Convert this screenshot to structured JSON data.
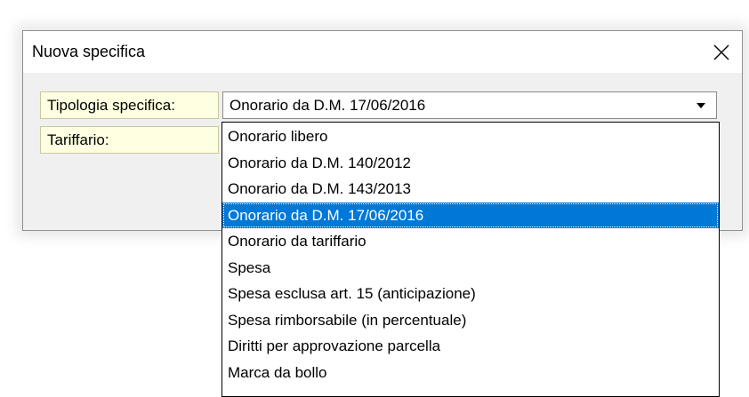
{
  "dialog": {
    "title": "Nuova specifica",
    "close_icon": "close-icon"
  },
  "form": {
    "tipologia_label": "Tipologia specifica:",
    "tipologia_value": "Onorario da D.M. 17/06/2016",
    "tariffario_label": "Tariffario:"
  },
  "dropdown": {
    "items": [
      "Onorario libero",
      "Onorario da D.M. 140/2012",
      "Onorario da D.M. 143/2013",
      "Onorario da D.M. 17/06/2016",
      "Onorario da tariffario",
      "Spesa",
      "Spesa esclusa art. 15 (anticipazione)",
      "Spesa rimborsabile (in percentuale)",
      "Diritti per approvazione parcella",
      "Marca da bollo"
    ],
    "selected_index": 3
  },
  "colors": {
    "selection": "#0078d7",
    "label_background": "#ffffe1",
    "dialog_background": "#f0f0f0"
  }
}
